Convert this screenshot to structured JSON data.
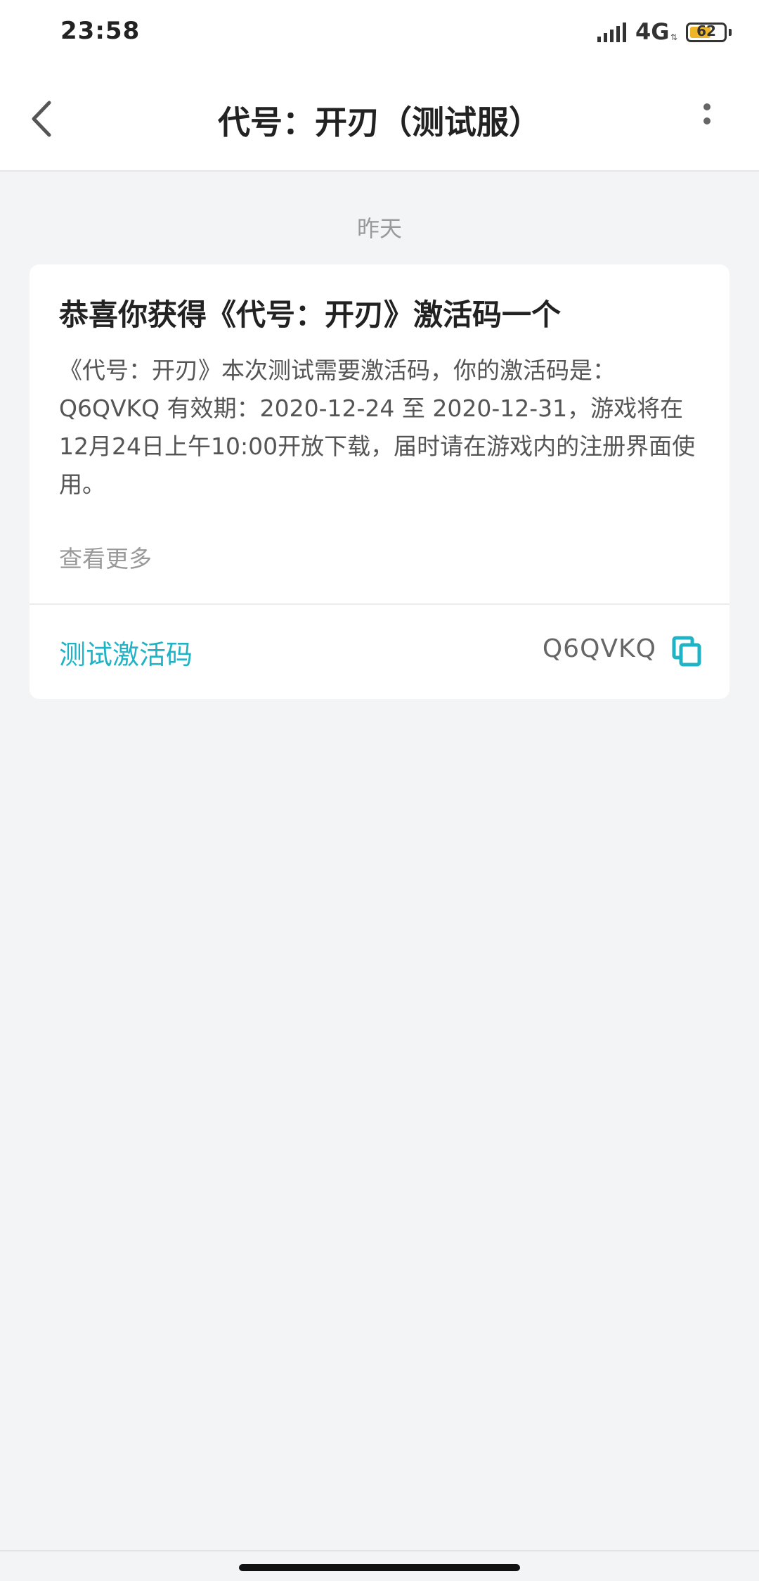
{
  "status_bar": {
    "time": "23:58",
    "network": "4G",
    "battery_level": 62,
    "battery_text": "62"
  },
  "header": {
    "title": "代号：开刃（测试服）",
    "back_icon": "chevron-left-icon",
    "more_icon": "more-vertical-icon"
  },
  "date_label": "昨天",
  "card": {
    "title": "恭喜你获得《代号：开刃》激活码一个",
    "body": "《代号：开刃》本次测试需要激活码，你的激活码是：Q6QVKQ 有效期：2020-12-24 至 2020-12-31，游戏将在12月24日上午10:00开放下载，届时请在游戏内的注册界面使用。",
    "more_link": "查看更多",
    "code_label": "测试激活码",
    "code_value": "Q6QVKQ",
    "copy_icon": "copy-icon"
  },
  "colors": {
    "accent": "#1fb3c5",
    "background": "#f3f4f6",
    "battery": "#f0b429"
  }
}
